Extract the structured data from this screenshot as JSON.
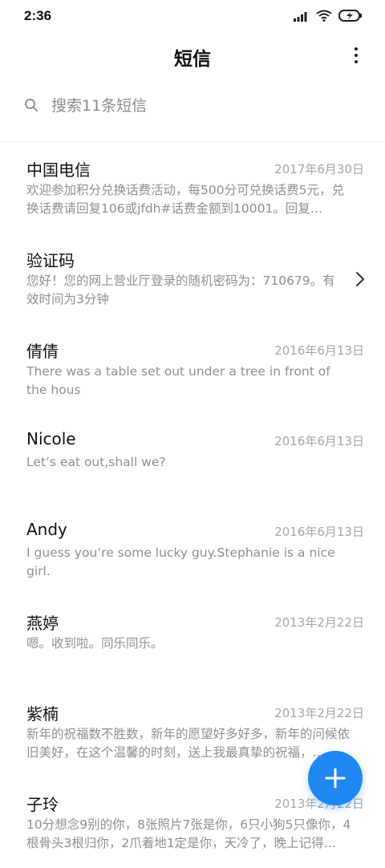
{
  "status_bar": {
    "time": "2:36"
  },
  "app_bar": {
    "title": "短信"
  },
  "search": {
    "placeholder": "搜索11条短信"
  },
  "messages": [
    {
      "name": "中国电信",
      "date": "2017年6月30日",
      "preview": "欢迎参加积分兑换话费活动，每500分可兑换话费5元，兑换话费请回复106或jfdh#话费金额到10001。回复…"
    },
    {
      "name": "验证码",
      "date": "",
      "preview": "您好！您的网上营业厅登录的随机密码为：710679。有效时间为3分钟"
    },
    {
      "name": "倩倩",
      "date": "2016年6月13日",
      "preview": "There was a table set out under a tree in front of the hous"
    },
    {
      "name": "Nicole",
      "date": "2016年6月13日",
      "preview": "Let’s eat out,shall we?"
    },
    {
      "name": "Andy",
      "date": "2016年6月13日",
      "preview": "I guess you’re some lucky guy.Stephanie is a nice girl."
    },
    {
      "name": "燕婷",
      "date": "2013年2月22日",
      "preview": "嗯。收到啦。同乐同乐。"
    },
    {
      "name": "紫楠",
      "date": "2013年2月22日",
      "preview": "新年的祝福数不胜数，新年的愿望好多好多，新年的问候依旧美好，在这个温馨的时刻，送上我最真挚的祝福，…"
    },
    {
      "name": "子玲",
      "date": "2013年2月22日",
      "preview": "10分想念9别的你，8张照片7张是你，6只小狗5只像你，4根骨头3根归你，2爪着地1定是你，天冷了，晚上记得…"
    }
  ],
  "colors": {
    "fab": "#1e88f0",
    "text_secondary": "#8f8f8f",
    "date": "#a6a6a6"
  },
  "icons": {
    "search": "search-icon",
    "more": "more-vert-icon",
    "chevron": "chevron-right-icon",
    "fab": "plus-icon"
  }
}
